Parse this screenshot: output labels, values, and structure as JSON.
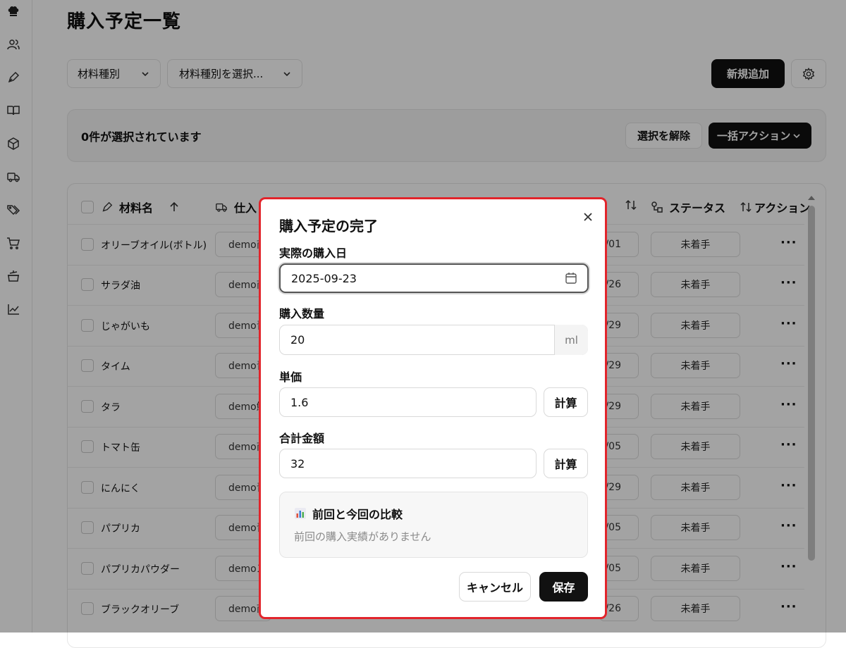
{
  "page": {
    "title": "購入予定一覧",
    "filter_type_label": "材料種別",
    "filter_select_label": "材料種別を選択...",
    "new_button": "新規追加",
    "selection_text": "0件が選択されています",
    "clear_selection": "選択を解除",
    "bulk_action": "一括アクション"
  },
  "table": {
    "headers": {
      "name": "材料名",
      "supplier": "仕入",
      "status": "ステータス",
      "action": "アクション"
    },
    "rows": [
      {
        "name": "オリーブオイル(ボトル)",
        "supplier": "demo商",
        "date": "/01",
        "status": "未着手"
      },
      {
        "name": "サラダ油",
        "supplier": "demo商",
        "date": "/26",
        "status": "未着手"
      },
      {
        "name": "じゃがいも",
        "supplier": "demo青",
        "date": "/29",
        "status": "未着手"
      },
      {
        "name": "タイム",
        "supplier": "demo青",
        "date": "/29",
        "status": "未着手"
      },
      {
        "name": "タラ",
        "supplier": "demo鮮",
        "date": "/29",
        "status": "未着手"
      },
      {
        "name": "トマト缶",
        "supplier": "demo商",
        "date": "/05",
        "status": "未着手"
      },
      {
        "name": "にんにく",
        "supplier": "demo青",
        "date": "/29",
        "status": "未着手"
      },
      {
        "name": "パプリカ",
        "supplier": "demo青",
        "date": "/05",
        "status": "未着手"
      },
      {
        "name": "パプリカパウダー",
        "supplier": "demoス",
        "date": "/05",
        "status": "未着手"
      },
      {
        "name": "ブラックオリーブ",
        "supplier": "demo商",
        "date": "/26",
        "status": "未着手"
      }
    ],
    "row_action": "···"
  },
  "modal": {
    "title": "購入予定の完了",
    "date_label": "実際の購入日",
    "date_value": "2025-09-23",
    "qty_label": "購入数量",
    "qty_value": "20",
    "qty_unit": "ml",
    "unit_price_label": "単価",
    "unit_price_value": "1.6",
    "calc_label": "計算",
    "total_label": "合計金額",
    "total_value": "32",
    "compare_title": "前回と今回の比較",
    "compare_message": "前回の購入実績がありません",
    "cancel": "キャンセル",
    "save": "保存"
  },
  "colors": {
    "accent_dark": "#111111",
    "highlight_border": "#e2242b",
    "overlay": "rgba(0,0,0,0.36)"
  }
}
